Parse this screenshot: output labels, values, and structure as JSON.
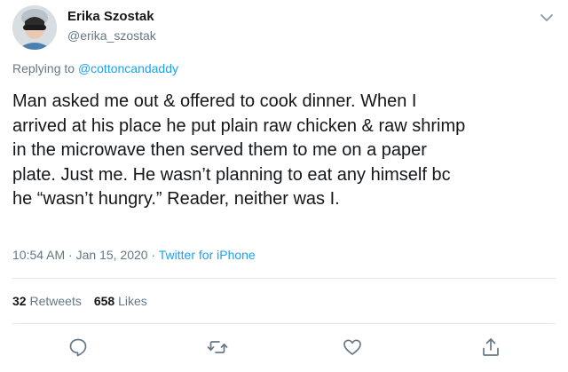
{
  "user": {
    "display_name": "Erika Szostak",
    "handle": "@erika_szostak"
  },
  "reply": {
    "prefix": "Replying to ",
    "mention": "@cottoncandaddy"
  },
  "tweet": {
    "lines": [
      "Man asked me out & offered to cook dinner. When I",
      "arrived at his place he put plain raw chicken & raw shrimp",
      "in the microwave then served them to me on a paper",
      "plate. Just me. He wasn’t planning to eat any himself bc",
      "he “wasn’t hungry.” Reader, neither was I."
    ]
  },
  "meta": {
    "time": "10:54 AM",
    "sep1": " · ",
    "date": "Jan 15, 2020",
    "sep2": " · ",
    "source": "Twitter for iPhone"
  },
  "stats": {
    "retweets_count": "32",
    "retweets_label": "Retweets",
    "likes_count": "658",
    "likes_label": "Likes"
  },
  "icons": {
    "caret": "chevron-down-icon",
    "reply": "comment-icon",
    "retweet": "retweet-icon",
    "like": "heart-icon",
    "share": "share-icon"
  },
  "colors": {
    "text": "#14171a",
    "secondary": "#657786",
    "link": "#1da1f2",
    "divider": "#e1e8ed"
  }
}
